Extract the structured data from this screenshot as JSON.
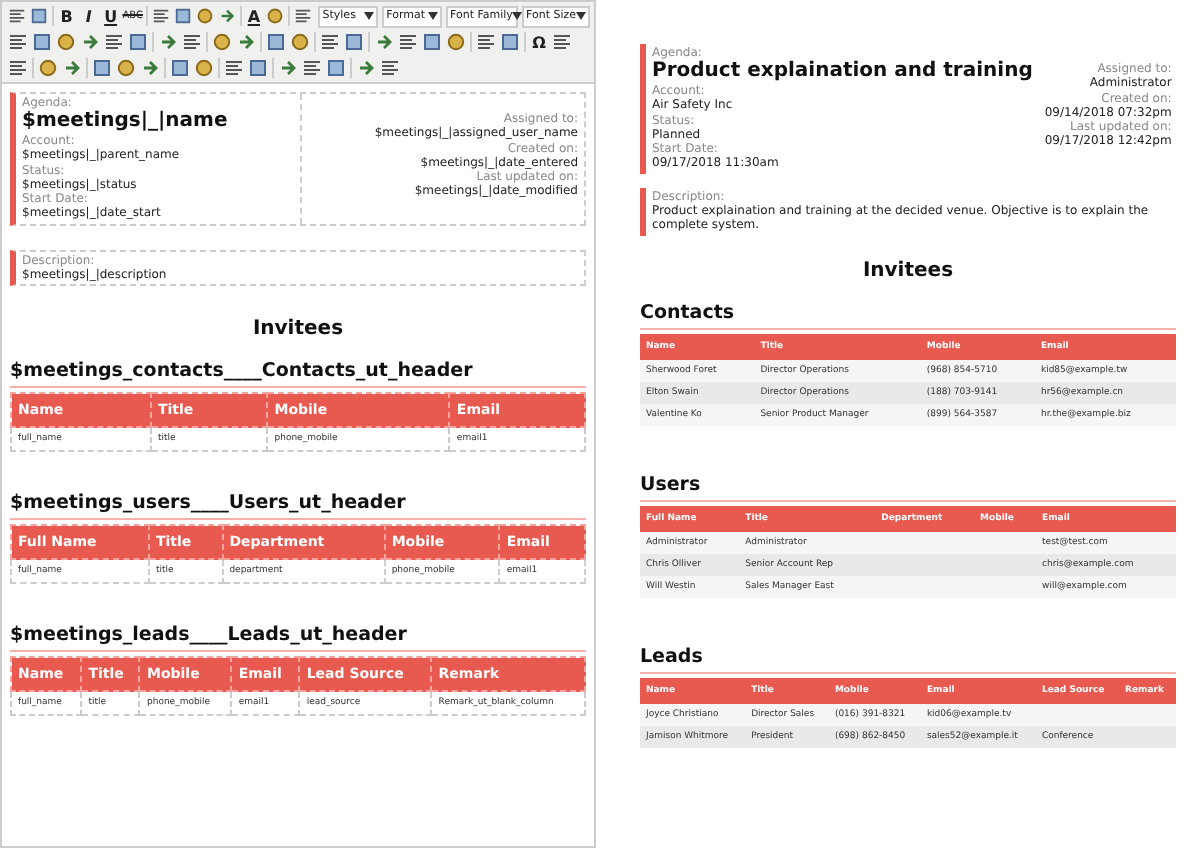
{
  "editor": {
    "toolbar": {
      "rows": [
        [
          {
            "kind": "icon"
          },
          {
            "kind": "icon"
          },
          {
            "kind": "sep"
          },
          {
            "kind": "bold",
            "text": "B"
          },
          {
            "kind": "italic",
            "text": "I"
          },
          {
            "kind": "underline",
            "text": "U"
          },
          {
            "kind": "strike",
            "text": "ABC"
          },
          {
            "kind": "sep"
          },
          {
            "kind": "icon"
          },
          {
            "kind": "icon"
          },
          {
            "kind": "icon"
          },
          {
            "kind": "icon"
          },
          {
            "kind": "sep"
          },
          {
            "kind": "underline",
            "text": "A"
          },
          {
            "kind": "icon"
          },
          {
            "kind": "sep"
          },
          {
            "kind": "icon"
          },
          {
            "kind": "dropdown",
            "label": "Styles"
          },
          {
            "kind": "dropdown",
            "label": "Format"
          },
          {
            "kind": "dropdown",
            "label": "Font Family"
          },
          {
            "kind": "dropdown",
            "label": "Font Size"
          }
        ],
        [
          {
            "kind": "icon"
          },
          {
            "kind": "icon"
          },
          {
            "kind": "icon"
          },
          {
            "kind": "icon"
          },
          {
            "kind": "icon"
          },
          {
            "kind": "icon"
          },
          {
            "kind": "sep"
          },
          {
            "kind": "icon"
          },
          {
            "kind": "icon"
          },
          {
            "kind": "sep"
          },
          {
            "kind": "icon"
          },
          {
            "kind": "icon"
          },
          {
            "kind": "sep"
          },
          {
            "kind": "icon"
          },
          {
            "kind": "icon"
          },
          {
            "kind": "sep"
          },
          {
            "kind": "icon"
          },
          {
            "kind": "icon"
          },
          {
            "kind": "sep"
          },
          {
            "kind": "icon"
          },
          {
            "kind": "icon"
          },
          {
            "kind": "icon"
          },
          {
            "kind": "icon"
          },
          {
            "kind": "sep"
          },
          {
            "kind": "icon"
          },
          {
            "kind": "icon"
          },
          {
            "kind": "sep"
          },
          {
            "kind": "bold",
            "text": "Ω"
          },
          {
            "kind": "icon"
          }
        ],
        [
          {
            "kind": "icon"
          },
          {
            "kind": "sep"
          },
          {
            "kind": "icon"
          },
          {
            "kind": "icon"
          },
          {
            "kind": "sep"
          },
          {
            "kind": "icon"
          },
          {
            "kind": "icon"
          },
          {
            "kind": "icon"
          },
          {
            "kind": "sep"
          },
          {
            "kind": "icon"
          },
          {
            "kind": "icon"
          },
          {
            "kind": "sep"
          },
          {
            "kind": "icon"
          },
          {
            "kind": "icon"
          },
          {
            "kind": "sep"
          },
          {
            "kind": "icon"
          },
          {
            "kind": "icon"
          },
          {
            "kind": "icon"
          },
          {
            "kind": "sep"
          },
          {
            "kind": "icon"
          },
          {
            "kind": "icon"
          }
        ]
      ]
    },
    "agenda_label": "Agenda:",
    "title": "$meetings|_|name",
    "fields_left": [
      {
        "label": "Account:",
        "value": "$meetings|_|parent_name"
      },
      {
        "label": "Status:",
        "value": "$meetings|_|status"
      },
      {
        "label": "Start Date:",
        "value": "$meetings|_|date_start"
      }
    ],
    "fields_right": [
      {
        "label": "Assigned to:",
        "value": "$meetings|_|assigned_user_name"
      },
      {
        "label": "Created on:",
        "value": "$meetings|_|date_entered"
      },
      {
        "label": "Last updated on:",
        "value": "$meetings|_|date_modified"
      }
    ],
    "description": {
      "label": "Description:",
      "value": "$meetings|_|description"
    },
    "invitees_title": "Invitees",
    "sections": [
      {
        "heading": "$meetings_contacts____Contacts_ut_header",
        "columns": [
          "Name",
          "Title",
          "Mobile",
          "Email"
        ],
        "rows": [
          [
            "full_name",
            "title",
            "phone_mobile",
            "email1"
          ]
        ]
      },
      {
        "heading": "$meetings_users____Users_ut_header",
        "columns": [
          "Full Name",
          "Title",
          "Department",
          "Mobile",
          "Email"
        ],
        "rows": [
          [
            "full_name",
            "title",
            "department",
            "phone_mobile",
            "email1"
          ]
        ]
      },
      {
        "heading": "$meetings_leads____Leads_ut_header",
        "columns": [
          "Name",
          "Title",
          "Mobile",
          "Email",
          "Lead Source",
          "Remark"
        ],
        "rows": [
          [
            "full_name",
            "title",
            "phone_mobile",
            "email1",
            "lead_source",
            "Remark_ut_blank_column"
          ]
        ]
      }
    ]
  },
  "preview": {
    "agenda_label": "Agenda:",
    "title": "Product explaination and training",
    "fields_left": [
      {
        "label": "Account:",
        "value": "Air Safety Inc"
      },
      {
        "label": "Status:",
        "value": "Planned"
      },
      {
        "label": "Start Date:",
        "value": "09/17/2018 11:30am"
      }
    ],
    "fields_right": [
      {
        "label": "Assigned to:",
        "value": "Administrator"
      },
      {
        "label": "Created on:",
        "value": "09/14/2018 07:32pm"
      },
      {
        "label": "Last updated on:",
        "value": "09/17/2018 12:42pm"
      }
    ],
    "description": {
      "label": "Description:",
      "value": "Product explaination and training at the decided venue. Objective is to explain the complete system."
    },
    "invitees_title": "Invitees",
    "sections": [
      {
        "heading": "Contacts",
        "columns": [
          "Name",
          "Title",
          "Mobile",
          "Email"
        ],
        "rows": [
          [
            "Sherwood Foret",
            "Director Operations",
            "(968) 854-5710",
            "kid85@example.tw"
          ],
          [
            "Elton Swain",
            "Director Operations",
            "(188) 703-9141",
            "hr56@example.cn"
          ],
          [
            "Valentine Ko",
            "Senior Product Manager",
            "(899) 564-3587",
            "hr.the@example.biz"
          ]
        ]
      },
      {
        "heading": "Users",
        "columns": [
          "Full Name",
          "Title",
          "Department",
          "Mobile",
          "Email"
        ],
        "rows": [
          [
            "Administrator",
            "Administrator",
            "",
            "",
            "test@test.com"
          ],
          [
            "Chris Olliver",
            "Senior Account Rep",
            "",
            "",
            "chris@example.com"
          ],
          [
            "Will Westin",
            "Sales Manager East",
            "",
            "",
            "will@example.com"
          ]
        ]
      },
      {
        "heading": "Leads",
        "columns": [
          "Name",
          "Title",
          "Mobile",
          "Email",
          "Lead Source",
          "Remark"
        ],
        "rows": [
          [
            "Joyce Christiano",
            "Director Sales",
            "(016) 391-8321",
            "kid06@example.tv",
            "",
            ""
          ],
          [
            "Jamison Whitmore",
            "President",
            "(698) 862-8450",
            "sales52@example.it",
            "Conference",
            ""
          ]
        ]
      }
    ]
  }
}
